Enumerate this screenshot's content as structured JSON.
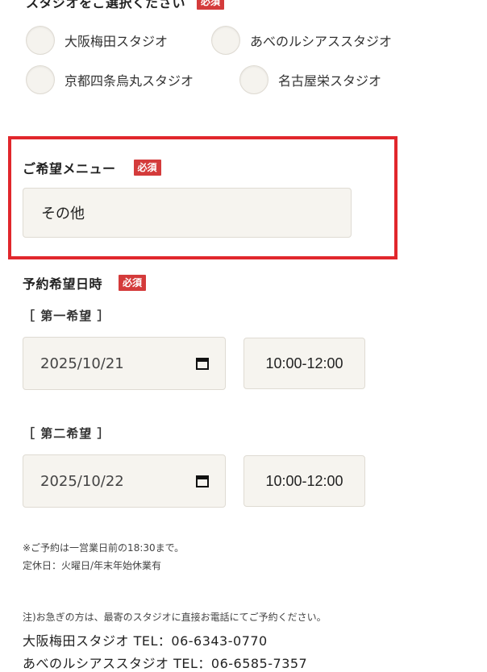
{
  "studio_section": {
    "title": "スタジオをご選択ください",
    "required": "必須",
    "options": [
      "大阪梅田スタジオ",
      "あべのルシアススタジオ",
      "京都四条烏丸スタジオ",
      "名古屋栄スタジオ"
    ]
  },
  "menu_section": {
    "title": "ご希望メニュー",
    "required": "必須",
    "value": "その他",
    "highlight_color": "#e1272c"
  },
  "datetime_section": {
    "title": "予約希望日時",
    "required": "必須",
    "first": {
      "label": "［ 第一希望 ］",
      "date": "2025/10/21",
      "time": "10:00-12:00"
    },
    "second": {
      "label": "［ 第二希望 ］",
      "date": "2025/10/22",
      "time": "10:00-12:00"
    }
  },
  "notes": {
    "line1": "※ご予約は一営業日前の18:30まで。",
    "line2": "定休日：火曜日/年末年始休業有",
    "line3": "注)お急ぎの方は、最寄のスタジオに直接お電話にてご予約ください。",
    "tel1": "大阪梅田スタジオ TEL：06-6343-0770",
    "tel2": "あべのルシアススタジオ TEL：06-6585-7357"
  },
  "icons": {
    "calendar": "calendar-icon"
  },
  "colors": {
    "required_badge": "#d43b3b",
    "field_bg": "#f6f4ef"
  }
}
